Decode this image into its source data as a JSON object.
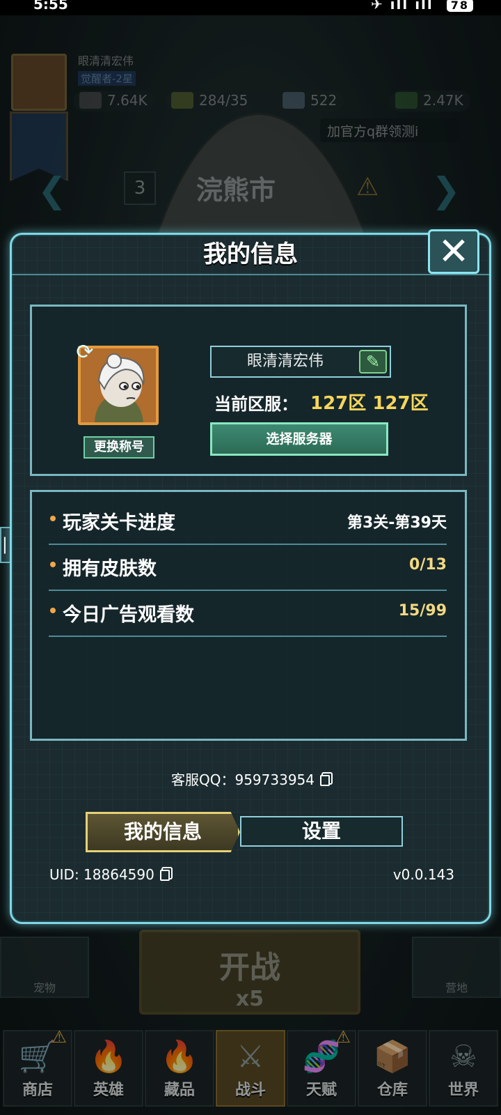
{
  "status_bar": {
    "time": "5:55",
    "signal": "✈ ıll ıll",
    "battery": "78"
  },
  "hud": {
    "player_name": "眼清清宏伟",
    "rank": "觉醒者-2星",
    "power": "7.64K",
    "energy": "284/35",
    "diamonds": "522",
    "cash": "2.47K",
    "notice": "加官方q群领测i",
    "city_index": "3",
    "city_name": "浣熊市",
    "start_label": "开战",
    "start_cost": "x5",
    "pet_label": "宠物",
    "camp_label": "营地"
  },
  "nav": [
    {
      "label": "商店",
      "icon": "🛒",
      "warn": true
    },
    {
      "label": "英雄",
      "icon": "🔥",
      "warn": false
    },
    {
      "label": "藏品",
      "icon": "🔥",
      "warn": false
    },
    {
      "label": "战斗",
      "icon": "⚔",
      "warn": false,
      "active": true
    },
    {
      "label": "天赋",
      "icon": "🧬",
      "warn": true
    },
    {
      "label": "仓库",
      "icon": "📦",
      "warn": false
    },
    {
      "label": "世界",
      "icon": "☠",
      "warn": false
    }
  ],
  "modal": {
    "title": "我的信息",
    "close_label": "✕",
    "change_title_label": "更换称号",
    "nickname": "眼清清宏伟",
    "server_label": "当前区服：",
    "server_value": "127区 127区",
    "select_server_label": "选择服务器",
    "stats": [
      {
        "label": "玩家关卡进度",
        "value": "第3关-第39天",
        "color": "#ffffff"
      },
      {
        "label": "拥有皮肤数",
        "value": "0/13",
        "color": "#f3d982"
      },
      {
        "label": "今日广告观看数",
        "value": "15/99",
        "color": "#f3d982"
      }
    ],
    "qq_label": "客服QQ：",
    "qq_number": "959733954",
    "tab_my_info": "我的信息",
    "tab_settings": "设置",
    "uid_label": "UID: ",
    "uid": "18864590",
    "version": "v0.0.143"
  }
}
